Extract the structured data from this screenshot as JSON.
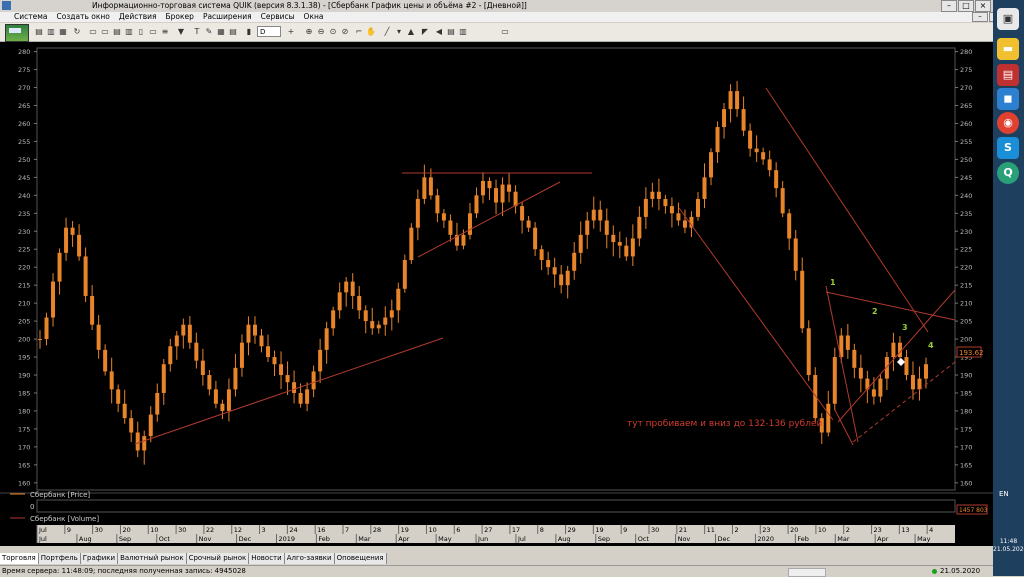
{
  "window": {
    "title": "Информационно-торговая система QUIK (версия 8.3.1.38) - [Сбербанк График цены и объёма #2 - [Дневной]]"
  },
  "menu": [
    "Система",
    "Создать окно",
    "Действия",
    "Брокер",
    "Расширения",
    "Сервисы",
    "Окна"
  ],
  "toolbar": {
    "interval": "D"
  },
  "chart": {
    "price_ticks": [
      280,
      275,
      270,
      265,
      260,
      255,
      250,
      245,
      240,
      235,
      230,
      225,
      220,
      215,
      210,
      205,
      200,
      195,
      190,
      185,
      180,
      175,
      170,
      165,
      160
    ],
    "current_price": "193.62",
    "annotation": "тут пробиваем и вниз до 132-136 рублей",
    "wave_labels": [
      "1",
      "2",
      "3",
      "4"
    ],
    "price_legend": "Сбербанк [Price]",
    "volume_legend": "Сбербанк [Volume]",
    "volume_tick": "0",
    "volume_value": "1457 803",
    "colors": {
      "candle": "#e8842a",
      "trendline": "#b03a2e",
      "label": "#9acd32",
      "annotation": "#d23b2e"
    },
    "x_axis_top": [
      "Jul",
      "9",
      "30",
      "20",
      "10",
      "30",
      "22",
      "12",
      "3",
      "24",
      "16",
      "7",
      "28",
      "19",
      "10",
      "6",
      "27",
      "17",
      "8",
      "29",
      "19",
      "9",
      "30",
      "21",
      "11",
      "2",
      "23",
      "20",
      "10",
      "2",
      "23",
      "13",
      "4"
    ],
    "x_axis_bottom": [
      "Jul",
      "Aug",
      "Sep",
      "Oct",
      "Nov",
      "Dec",
      "2019",
      "Feb",
      "Mar",
      "Apr",
      "May",
      "Jun",
      "Jul",
      "Aug",
      "Sep",
      "Oct",
      "Nov",
      "Dec",
      "2020",
      "Feb",
      "Mar",
      "Apr",
      "May"
    ]
  },
  "chart_data": {
    "type": "candlestick",
    "ylim": [
      158,
      281
    ],
    "series": [
      {
        "name": "Сбербанк [Price]",
        "values": [
          200,
          206,
          216,
          224,
          231,
          229,
          223,
          212,
          204,
          197,
          191,
          186,
          182,
          178,
          174,
          169,
          173,
          179,
          185,
          193,
          198,
          201,
          204,
          199,
          194,
          190,
          186,
          182,
          180,
          186,
          192,
          199,
          204,
          201,
          198,
          195,
          193,
          190,
          188,
          185,
          182,
          186,
          191,
          197,
          203,
          208,
          213,
          216,
          212,
          208,
          205,
          203,
          204,
          206,
          208,
          214,
          222,
          231,
          239,
          245,
          240,
          235,
          233,
          229,
          226,
          229,
          235,
          240,
          244,
          242,
          238,
          243,
          241,
          237,
          233,
          231,
          225,
          222,
          220,
          218,
          215,
          219,
          224,
          229,
          233,
          236,
          233,
          229,
          227,
          226,
          223,
          228,
          234,
          239,
          241,
          239,
          237,
          235,
          233,
          231,
          234,
          239,
          245,
          252,
          259,
          264,
          269,
          264,
          258,
          253,
          252,
          250,
          247,
          242,
          235,
          228,
          219,
          203,
          190,
          178,
          174,
          182,
          195,
          201,
          197,
          192,
          189,
          186,
          184,
          189,
          195,
          199,
          195,
          190,
          186,
          189,
          193
        ]
      }
    ]
  },
  "tabs": [
    "Торговля",
    "Портфель",
    "Графики",
    "Валютный рынок",
    "Срочный рынок",
    "Новости",
    "Алго-заявки",
    "Оповещения"
  ],
  "status": {
    "text": "Время сервера: 11:48:09; последняя полученная запись: 4945028",
    "date": "21.05.2020"
  },
  "taskbar": {
    "lang": "EN",
    "time": "11:48",
    "date": "21.05.2020"
  }
}
